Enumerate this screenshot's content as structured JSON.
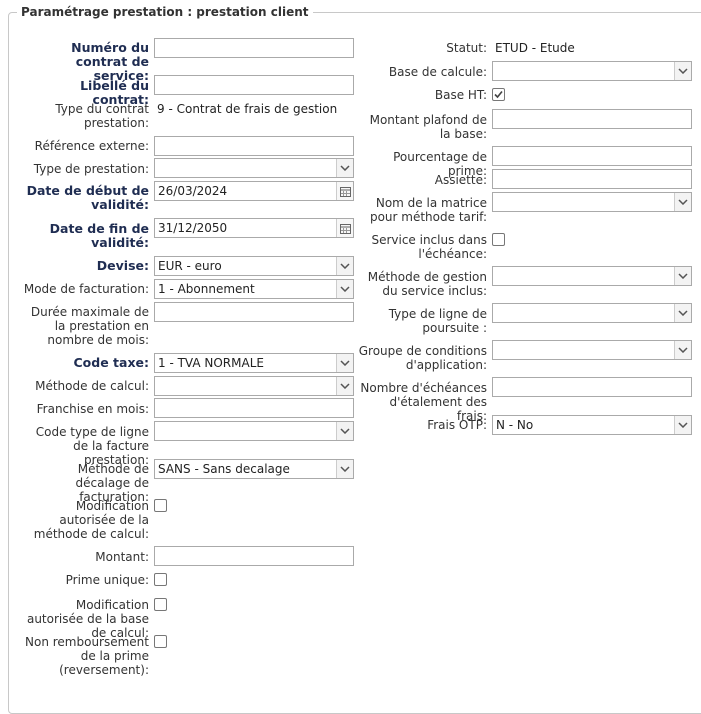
{
  "legend": "Paramétrage prestation : prestation client",
  "left": {
    "numero_contrat": {
      "label": "Numéro du contrat de service:",
      "value": ""
    },
    "libelle_contrat": {
      "label": "Libellé du contrat:",
      "value": ""
    },
    "type_contrat": {
      "label": "Type du contrat prestation:",
      "value": "9 - Contrat de frais de gestion"
    },
    "reference_externe": {
      "label": "Référence externe:",
      "value": ""
    },
    "type_prestation": {
      "label": "Type de prestation:",
      "value": ""
    },
    "date_debut": {
      "label": "Date de début de validité:",
      "value": "26/03/2024"
    },
    "date_fin": {
      "label": "Date de fin de validité:",
      "value": "31/12/2050"
    },
    "devise": {
      "label": "Devise:",
      "value": "EUR - euro"
    },
    "mode_facturation": {
      "label": "Mode de facturation:",
      "value": "1 - Abonnement"
    },
    "duree_max": {
      "label": "Durée maximale de la prestation en nombre de mois:",
      "value": ""
    },
    "code_taxe": {
      "label": "Code taxe:",
      "value": "1 - TVA NORMALE"
    },
    "methode_calcul": {
      "label": "Méthode de calcul:",
      "value": ""
    },
    "franchise": {
      "label": "Franchise en mois:",
      "value": ""
    },
    "code_type_ligne": {
      "label": "Code type de ligne de la facture prestation:",
      "value": ""
    },
    "methode_decalage": {
      "label": "Méthode de décalage de facturation:",
      "value": "SANS - Sans decalage"
    },
    "modif_methode_calcul": {
      "label": "Modification autorisée de la méthode de calcul:",
      "checked": false
    },
    "montant": {
      "label": "Montant:",
      "value": ""
    },
    "prime_unique": {
      "label": "Prime unique:",
      "checked": false
    },
    "modif_base_calcul": {
      "label": "Modification autorisée de la base de calcul:",
      "checked": false
    },
    "non_remboursement": {
      "label": "Non remboursement de la prime (reversement):",
      "checked": false
    }
  },
  "right": {
    "statut": {
      "label": "Statut:",
      "value": "ETUD - Etude"
    },
    "base_calcule": {
      "label": "Base de calcule:",
      "value": ""
    },
    "base_ht": {
      "label": "Base HT:",
      "checked": true
    },
    "montant_plafond": {
      "label": "Montant plafond de la base:",
      "value": ""
    },
    "pourcentage_prime": {
      "label": "Pourcentage de prime:",
      "value": ""
    },
    "assiette": {
      "label": "Assiette:",
      "value": ""
    },
    "nom_matrice": {
      "label": "Nom de la matrice pour méthode tarif:",
      "value": ""
    },
    "service_inclus": {
      "label": "Service inclus dans l'échéance:",
      "checked": false
    },
    "methode_gestion": {
      "label": "Méthode de gestion du service inclus:",
      "value": ""
    },
    "type_ligne_poursuite": {
      "label": "Type de ligne de poursuite :",
      "value": ""
    },
    "groupe_conditions": {
      "label": "Groupe de conditions d'application:",
      "value": ""
    },
    "nombre_echeances": {
      "label": "Nombre d'échéances d'étalement des frais:",
      "value": ""
    },
    "frais_otp": {
      "label": "Frais OTP:",
      "value": "N - No"
    }
  }
}
